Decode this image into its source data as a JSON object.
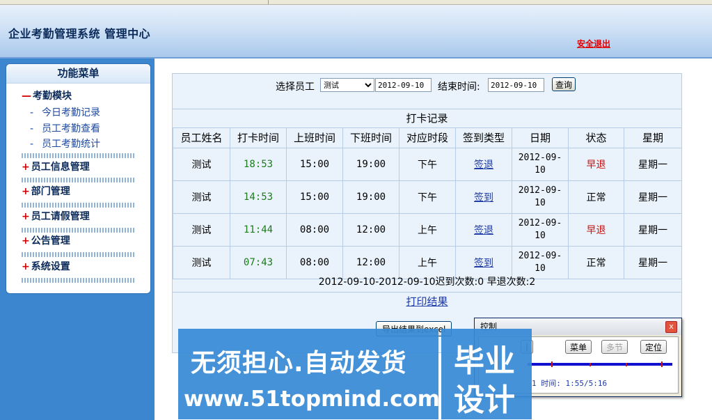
{
  "header": {
    "title": "企业考勤管理系统 管理中心",
    "logout": "安全退出"
  },
  "menu": {
    "title": "功能菜单",
    "attendance_module": {
      "sign": "—",
      "label": "考勤模块"
    },
    "attendance_items": [
      "今日考勤记录",
      "员工考勤查看",
      "员工考勤统计"
    ],
    "sections": [
      {
        "sign": "+",
        "label": "员工信息管理"
      },
      {
        "sign": "+",
        "label": "部门管理"
      },
      {
        "sign": "+",
        "label": "员工请假管理"
      },
      {
        "sign": "+",
        "label": "公告管理"
      },
      {
        "sign": "+",
        "label": "系统设置"
      }
    ]
  },
  "filter": {
    "employee_label": "选择员工",
    "employee_selected": "测试",
    "start_date": "2012-09-10",
    "end_label": "结束时间:",
    "end_date": "2012-09-10",
    "query_button": "查询"
  },
  "records": {
    "title": "打卡记录",
    "columns": [
      "员工姓名",
      "打卡时间",
      "上班时间",
      "下班时间",
      "对应时段",
      "签到类型",
      "日期",
      "状态",
      "星期"
    ],
    "rows": [
      {
        "name": "测试",
        "punch": "18:53",
        "start": "15:00",
        "end": "19:00",
        "period": "下午",
        "type": "签退",
        "date_a": "2012-09-",
        "date_b": "10",
        "status": "早退",
        "weekday": "星期一"
      },
      {
        "name": "测试",
        "punch": "14:53",
        "start": "15:00",
        "end": "19:00",
        "period": "下午",
        "type": "签到",
        "date_a": "2012-09-",
        "date_b": "10",
        "status": "正常",
        "weekday": "星期一"
      },
      {
        "name": "测试",
        "punch": "11:44",
        "start": "08:00",
        "end": "12:00",
        "period": "上午",
        "type": "签退",
        "date_a": "2012-09-",
        "date_b": "10",
        "status": "早退",
        "weekday": "星期一"
      },
      {
        "name": "测试",
        "punch": "07:43",
        "start": "08:00",
        "end": "12:00",
        "period": "上午",
        "type": "签到",
        "date_a": "2012-09-",
        "date_b": "10",
        "status": "正常",
        "weekday": "星期一"
      }
    ],
    "summary": "2012-09-10-2012-09-10迟到次数:0 早退次数:2",
    "print_link": "打印结果",
    "export_button": "导出结果到excel"
  },
  "control_window": {
    "title": "控制",
    "close": "x",
    "buttons": {
      "left": "|",
      "menu": "菜单",
      "chapter": "多节",
      "locate": "定位"
    },
    "status_text": "1 时间: 1:55/5:16"
  },
  "watermark": {
    "line1": "无须担心.自动发货",
    "line2": "www.51topmind.com",
    "side1": "毕业",
    "side2": "设计"
  },
  "colors": {
    "sidebar": "#3c86d0",
    "panel": "#eaf3fb",
    "late_status": "#c81010",
    "punch_time": "#1d7a1d",
    "watermark": "#378ad6"
  }
}
